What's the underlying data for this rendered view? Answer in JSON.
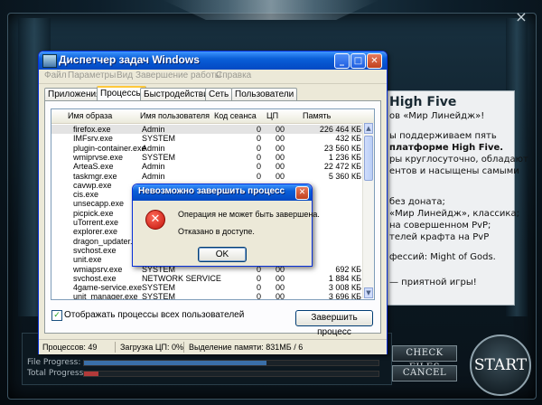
{
  "launcher": {
    "close_glyph": "×",
    "news": {
      "title": "High Five",
      "lines": [
        "ов «Мир Линейдж»!",
        "",
        "ы поддерживаем пять",
        "платформе High Five.",
        "ры круглосуточно, обладают",
        "ентов и насыщены самыми",
        "",
        "",
        "без доната;",
        "«Мир Линейдж», классика;",
        "на совершенном PvP;",
        "телей крафта на PvP",
        "",
        "фессий: Might of Gods.",
        "",
        "— приятной игры!"
      ]
    },
    "progress": {
      "file_label": "File Progress:",
      "total_label": "Total Progress:",
      "file_fraction": 0.62,
      "total_fraction": 0.05
    },
    "buttons": {
      "check_files": "CHECK FILES",
      "cancel": "CANCEL",
      "start": "START"
    }
  },
  "taskmgr": {
    "title": "Диспетчер задач Windows",
    "title_buttons": {
      "minimize": "_",
      "maximize": "□",
      "close": "✕"
    },
    "menu": [
      "Файл",
      "Параметры",
      "Вид",
      "Завершение работы",
      "Справка"
    ],
    "tabs": [
      "Приложения",
      "Процессы",
      "Быстродействие",
      "Сеть",
      "Пользователи"
    ],
    "columns": [
      "Имя образа",
      "Имя пользователя",
      "Код сеанса",
      "ЦП",
      "Память"
    ],
    "processes": [
      [
        "firefox.exe",
        "Admin",
        "0",
        "00",
        "226 464 КБ"
      ],
      [
        "IMFsrv.exe",
        "SYSTEM",
        "0",
        "00",
        "432 КБ"
      ],
      [
        "plugin-container.exe",
        "Admin",
        "0",
        "00",
        "23 560 КБ"
      ],
      [
        "wmiprvse.exe",
        "SYSTEM",
        "0",
        "00",
        "1 236 КБ"
      ],
      [
        "ArteaS.exe",
        "Admin",
        "0",
        "00",
        "22 472 КБ"
      ],
      [
        "taskmgr.exe",
        "Admin",
        "0",
        "00",
        "5 360 КБ"
      ],
      [
        "cavwp.exe",
        "",
        "",
        "",
        ""
      ],
      [
        "cis.exe",
        "",
        "",
        "",
        ""
      ],
      [
        "unsecapp.exe",
        "",
        "",
        "",
        ""
      ],
      [
        "picpick.exe",
        "",
        "",
        "",
        ""
      ],
      [
        "uTorrent.exe",
        "",
        "",
        "",
        ""
      ],
      [
        "explorer.exe",
        "",
        "",
        "",
        ""
      ],
      [
        "dragon_updater....",
        "",
        "",
        "",
        ""
      ],
      [
        "svchost.exe",
        "",
        "",
        "",
        ""
      ],
      [
        "unit.exe",
        "",
        "",
        "",
        ""
      ],
      [
        "wmiapsrv.exe",
        "SYSTEM",
        "0",
        "00",
        "692 КБ"
      ],
      [
        "svchost.exe",
        "NETWORK SERVICE",
        "0",
        "00",
        "1 884 КБ"
      ],
      [
        "4game-service.exe",
        "SYSTEM",
        "0",
        "00",
        "3 008 КБ"
      ],
      [
        "unit_manager.exe",
        "SYSTEM",
        "0",
        "00",
        "3 696 КБ"
      ]
    ],
    "show_all_label": "Отображать процессы всех пользователей",
    "show_all_checked": "✓",
    "end_process_label": "Завершить процесс",
    "status": {
      "processes": "Процессов: 49",
      "cpu": "Загрузка ЦП: 0%",
      "memory": "Выделение памяти: 831МБ / 6"
    }
  },
  "dialog": {
    "title": "Невозможно завершить процесс",
    "close_glyph": "✕",
    "icon_glyph": "✕",
    "message1": "Операция не может быть завершена.",
    "message2": "Отказано в доступе.",
    "ok_label": "OK"
  }
}
